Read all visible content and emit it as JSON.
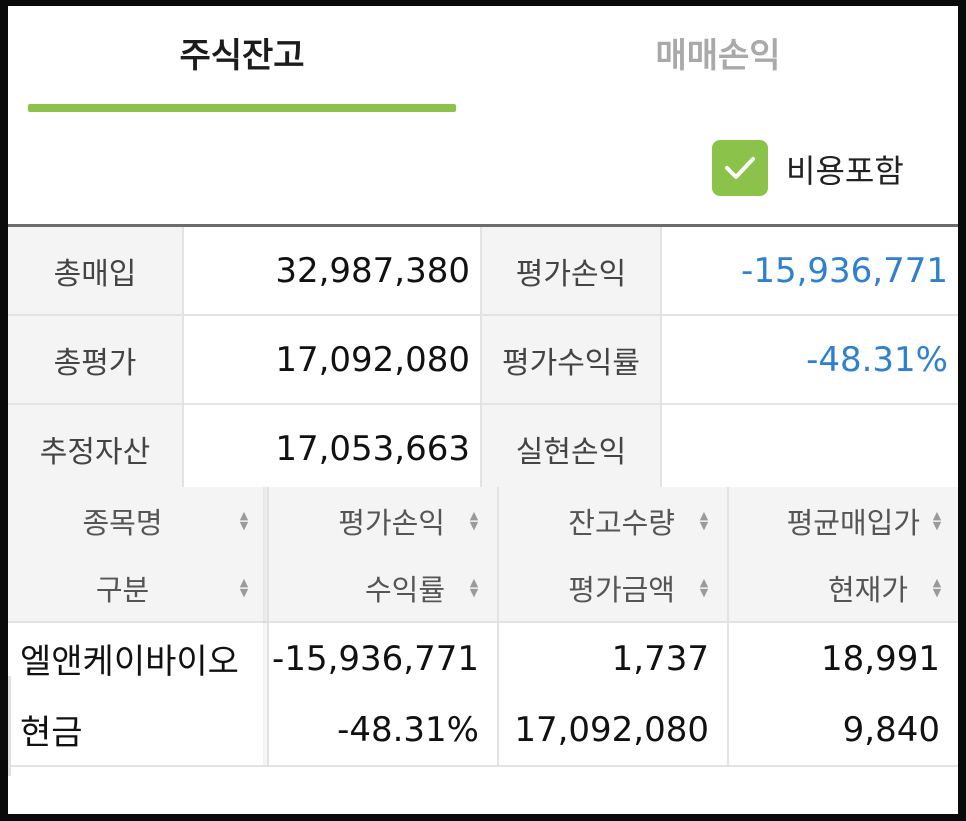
{
  "tabs": {
    "active_label": "주식잔고",
    "inactive_label": "매매손익"
  },
  "options": {
    "include_cost_label": "비용포함",
    "include_cost_checked": true
  },
  "summary": {
    "total_purchase_label": "총매입",
    "total_purchase_value": "32,987,380",
    "eval_pl_label": "평가손익",
    "eval_pl_value": "-15,936,771",
    "total_eval_label": "총평가",
    "total_eval_value": "17,092,080",
    "eval_return_label": "평가수익률",
    "eval_return_value": "-48.31%",
    "est_assets_label": "추정자산",
    "est_assets_value": "17,053,663",
    "realized_pl_label": "실현손익",
    "realized_pl_value": ""
  },
  "list_header": {
    "col1_top": "종목명",
    "col1_bottom": "구분",
    "col2_top": "평가손익",
    "col2_bottom": "수익률",
    "col3_top": "잔고수량",
    "col3_bottom": "평가금액",
    "col4_top": "평균매입가",
    "col4_bottom": "현재가"
  },
  "holdings": [
    {
      "name": "엘앤케이바이오",
      "type": "현금",
      "eval_pl": "-15,936,771",
      "return_rate": "-48.31%",
      "quantity": "1,737",
      "eval_amount": "17,092,080",
      "avg_price": "18,991",
      "current_price": "9,840"
    }
  ],
  "colors": {
    "accent_green": "#8bc34a",
    "negative_blue": "#2f80d0",
    "price_red": "#d32f2f"
  }
}
